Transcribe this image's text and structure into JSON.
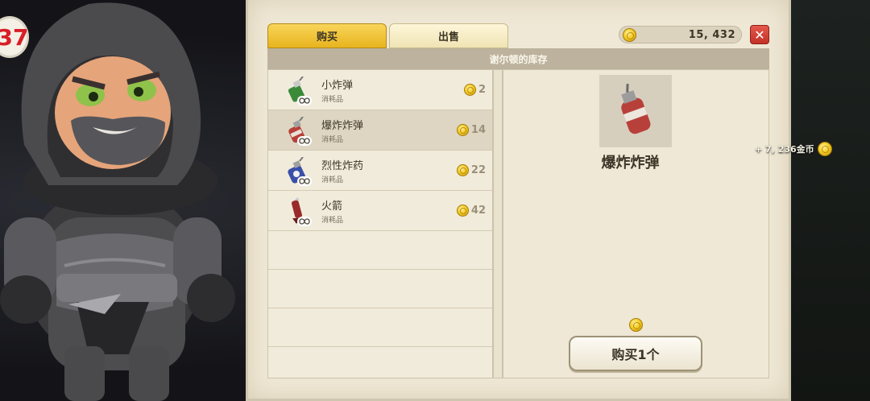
{
  "player": {
    "level_badge": "37"
  },
  "tabs": {
    "buy_label": "购买",
    "sell_label": "出售",
    "active": "buy"
  },
  "wallet": {
    "coins": "15, 432"
  },
  "shop": {
    "header": "谢尔顿的库存",
    "items": [
      {
        "name": "小炸弹",
        "type": "消耗品",
        "price": "2",
        "icon": "small-bomb-icon",
        "color": "#3b8a3a"
      },
      {
        "name": "爆炸炸弹",
        "type": "消耗品",
        "price": "14",
        "icon": "blast-bomb-icon",
        "color": "#b8403a"
      },
      {
        "name": "烈性炸药",
        "type": "消耗品",
        "price": "22",
        "icon": "high-explosive-icon",
        "color": "#3a4fa8"
      },
      {
        "name": "火箭",
        "type": "消耗品",
        "price": "42",
        "icon": "rocket-icon",
        "color": "#9a2a2a"
      }
    ],
    "selected_index": 1
  },
  "detail": {
    "name": "爆炸炸弹",
    "buy_label": "购买1个"
  },
  "notification": {
    "gold_gain": "+ 7, 236金币"
  },
  "colors": {
    "accent": "#e8b41e",
    "parchment": "#efe8d6",
    "close": "#c33227"
  }
}
